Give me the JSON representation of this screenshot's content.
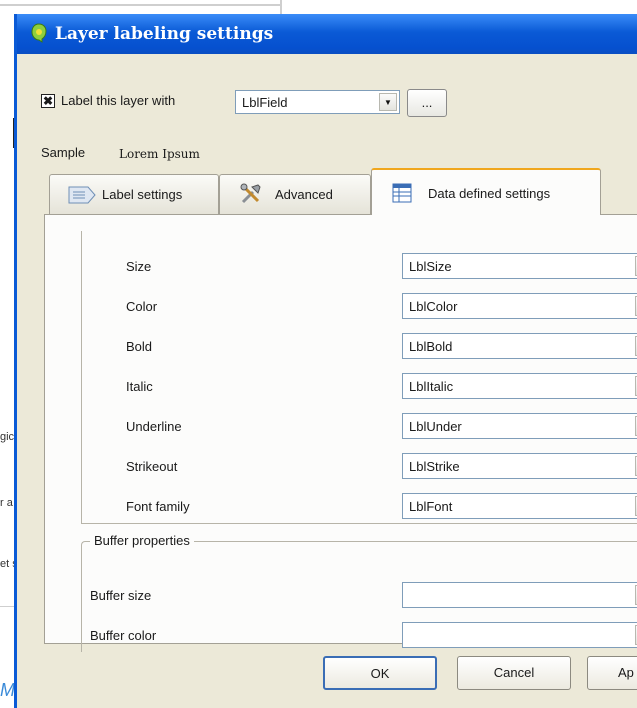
{
  "background": {
    "fragments": [
      "gic",
      "r a",
      "et s"
    ],
    "link_text": "Ma"
  },
  "dialog": {
    "title": "Layer labeling settings",
    "label_checkbox": {
      "checked": true,
      "label": "Label this layer with"
    },
    "label_field": "LblField",
    "browse_button": "...",
    "sample": {
      "label": "Sample",
      "text": "Lorem Ipsum"
    },
    "tabs": [
      {
        "label": "Label settings",
        "icon": "label-settings-icon",
        "active": false
      },
      {
        "label": "Advanced",
        "icon": "tools-icon",
        "active": false
      },
      {
        "label": "Data defined settings",
        "icon": "table-icon",
        "active": true
      }
    ],
    "properties": [
      {
        "label": "Size",
        "value": "LblSize"
      },
      {
        "label": "Color",
        "value": "LblColor"
      },
      {
        "label": "Bold",
        "value": "LblBold"
      },
      {
        "label": "Italic",
        "value": "LblItalic"
      },
      {
        "label": "Underline",
        "value": "LblUnder"
      },
      {
        "label": "Strikeout",
        "value": "LblStrike"
      },
      {
        "label": "Font family",
        "value": "LblFont"
      }
    ],
    "buffer": {
      "title": "Buffer properties",
      "rows": [
        {
          "label": "Buffer size",
          "value": ""
        },
        {
          "label": "Buffer color",
          "value": ""
        }
      ]
    },
    "buttons": {
      "ok": "OK",
      "cancel": "Cancel",
      "apply": "Ap"
    }
  },
  "colors": {
    "title_bar": "#0a5ad6",
    "dialog_bg": "#ece9d8",
    "active_tab_accent": "#f0a71e"
  }
}
